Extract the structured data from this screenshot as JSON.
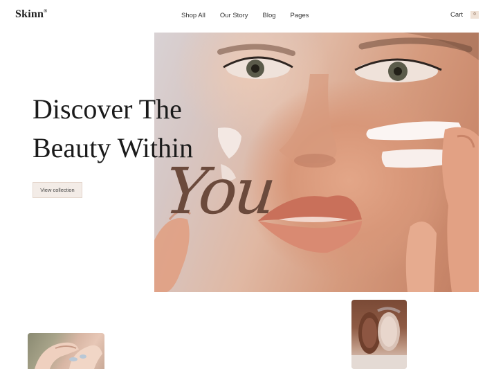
{
  "brand": {
    "name": "Skinn",
    "mark": "®"
  },
  "nav": {
    "items": [
      {
        "label": "Shop All"
      },
      {
        "label": "Our Story"
      },
      {
        "label": "Blog"
      },
      {
        "label": "Pages"
      }
    ],
    "cart_label": "Cart",
    "cart_count": "0"
  },
  "hero": {
    "headline_line1": "Discover The",
    "headline_line2": "Beauty Within",
    "script_word": "You",
    "cta_label": "View collection"
  },
  "colors": {
    "script_accent": "#6b4a3c",
    "button_bg": "#f3ece7",
    "badge_bg": "#f0e2d6"
  }
}
